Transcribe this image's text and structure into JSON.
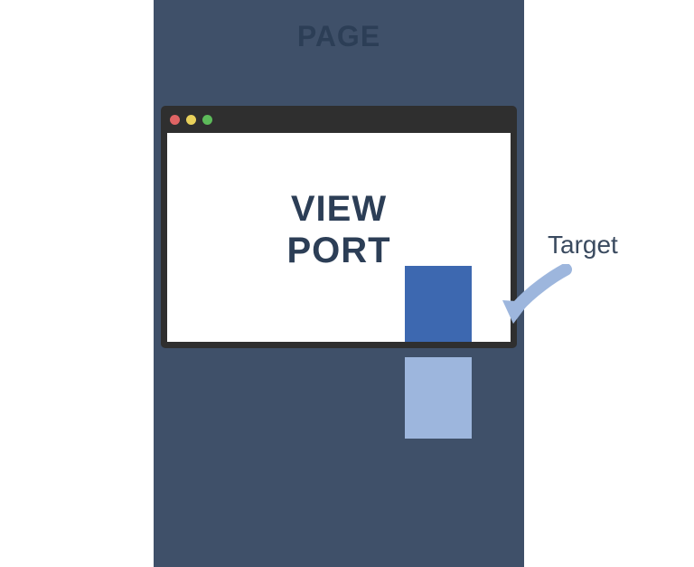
{
  "page": {
    "label": "PAGE"
  },
  "viewport": {
    "line1": "VIEW",
    "line2": "PORT"
  },
  "target": {
    "label": "Target"
  }
}
